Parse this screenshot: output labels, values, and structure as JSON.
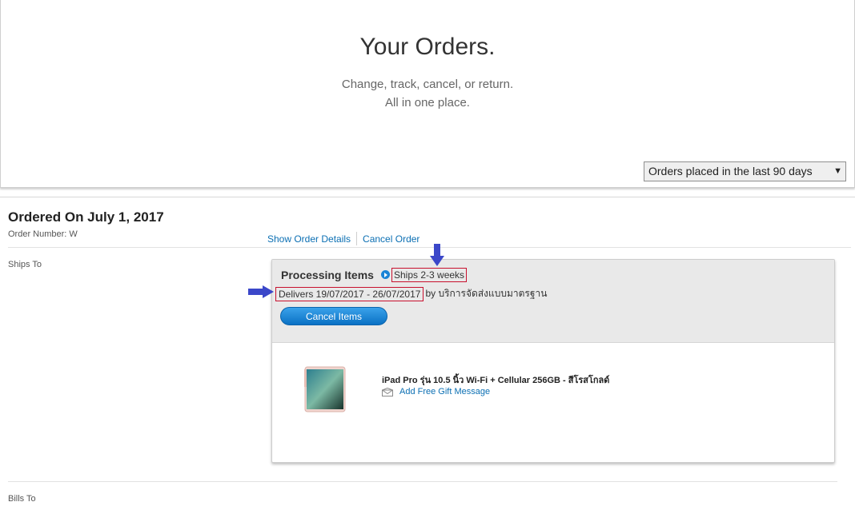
{
  "header": {
    "title": "Your Orders.",
    "subtitle_line1": "Change, track, cancel, or return.",
    "subtitle_line2": "All in one place.",
    "filter": {
      "selected": "Orders placed in the last 90 days",
      "caret": "▼"
    }
  },
  "order": {
    "heading": "Ordered On July 1, 2017",
    "number_label": "Order Number: W",
    "actions": {
      "show_details": "Show Order Details",
      "cancel_order": "Cancel Order"
    },
    "ships_to_label": "Ships To",
    "bills_to_label": "Bills To",
    "shipment": {
      "status": "Processing Items",
      "ships_eta": "Ships 2-3 weeks",
      "delivers_range": "Delivers 19/07/2017 - 26/07/2017",
      "delivers_carrier": "by บริการจัดส่งแบบมาตรฐาน",
      "cancel_button": "Cancel Items",
      "product": {
        "name": "iPad Pro รุ่น 10.5 นิ้ว Wi-Fi + Cellular 256GB - สีโรสโกลด์",
        "gift_link": "Add Free Gift Message",
        "image_icon": "ipad-product-image"
      }
    }
  },
  "colors": {
    "link": "#0b6fb3",
    "button": "#0a71c4",
    "annotation_box": "#c8102e",
    "annotation_arrow": "#3b47c9"
  }
}
